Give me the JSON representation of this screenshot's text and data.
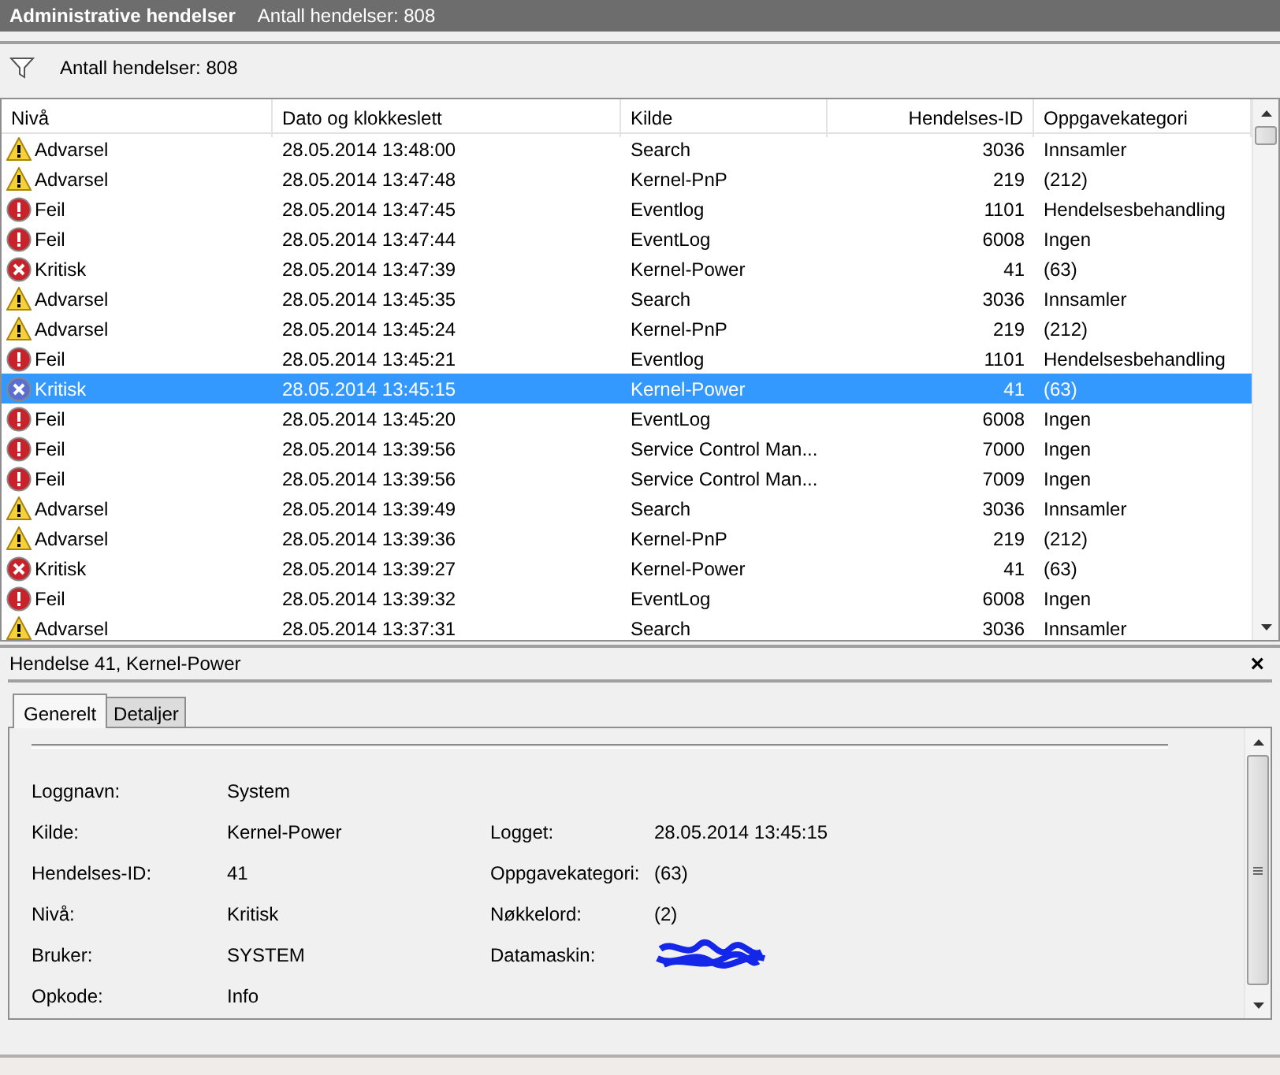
{
  "window": {
    "title": "Administrative hendelser",
    "subtitle": "Antall hendelser: 808"
  },
  "filter_bar": {
    "text": "Antall hendelser: 808"
  },
  "table": {
    "columns": [
      {
        "label": "Nivå",
        "kind": "text"
      },
      {
        "label": "Dato og klokkeslett",
        "kind": "text"
      },
      {
        "label": "Kilde",
        "kind": "text"
      },
      {
        "label": "Hendelses-ID",
        "kind": "number"
      },
      {
        "label": "Oppgavekategori",
        "kind": "text"
      }
    ],
    "rows": [
      {
        "kind": "warning",
        "level": "Advarsel",
        "date": "28.05.2014 13:48:00",
        "source": "Search",
        "id": "3036",
        "category": "Innsamler",
        "selected": false
      },
      {
        "kind": "warning",
        "level": "Advarsel",
        "date": "28.05.2014 13:47:48",
        "source": "Kernel-PnP",
        "id": "219",
        "category": "(212)",
        "selected": false
      },
      {
        "kind": "error",
        "level": "Feil",
        "date": "28.05.2014 13:47:45",
        "source": "Eventlog",
        "id": "1101",
        "category": "Hendelsesbehandling",
        "selected": false
      },
      {
        "kind": "error",
        "level": "Feil",
        "date": "28.05.2014 13:47:44",
        "source": "EventLog",
        "id": "6008",
        "category": "Ingen",
        "selected": false
      },
      {
        "kind": "critical",
        "level": "Kritisk",
        "date": "28.05.2014 13:47:39",
        "source": "Kernel-Power",
        "id": "41",
        "category": "(63)",
        "selected": false
      },
      {
        "kind": "warning",
        "level": "Advarsel",
        "date": "28.05.2014 13:45:35",
        "source": "Search",
        "id": "3036",
        "category": "Innsamler",
        "selected": false
      },
      {
        "kind": "warning",
        "level": "Advarsel",
        "date": "28.05.2014 13:45:24",
        "source": "Kernel-PnP",
        "id": "219",
        "category": "(212)",
        "selected": false
      },
      {
        "kind": "error",
        "level": "Feil",
        "date": "28.05.2014 13:45:21",
        "source": "Eventlog",
        "id": "1101",
        "category": "Hendelsesbehandling",
        "selected": false
      },
      {
        "kind": "critical",
        "level": "Kritisk",
        "date": "28.05.2014 13:45:15",
        "source": "Kernel-Power",
        "id": "41",
        "category": "(63)",
        "selected": true
      },
      {
        "kind": "error",
        "level": "Feil",
        "date": "28.05.2014 13:45:20",
        "source": "EventLog",
        "id": "6008",
        "category": "Ingen",
        "selected": false
      },
      {
        "kind": "error",
        "level": "Feil",
        "date": "28.05.2014 13:39:56",
        "source": "Service Control Man...",
        "id": "7000",
        "category": "Ingen",
        "selected": false
      },
      {
        "kind": "error",
        "level": "Feil",
        "date": "28.05.2014 13:39:56",
        "source": "Service Control Man...",
        "id": "7009",
        "category": "Ingen",
        "selected": false
      },
      {
        "kind": "warning",
        "level": "Advarsel",
        "date": "28.05.2014 13:39:49",
        "source": "Search",
        "id": "3036",
        "category": "Innsamler",
        "selected": false
      },
      {
        "kind": "warning",
        "level": "Advarsel",
        "date": "28.05.2014 13:39:36",
        "source": "Kernel-PnP",
        "id": "219",
        "category": "(212)",
        "selected": false
      },
      {
        "kind": "critical",
        "level": "Kritisk",
        "date": "28.05.2014 13:39:27",
        "source": "Kernel-Power",
        "id": "41",
        "category": "(63)",
        "selected": false
      },
      {
        "kind": "error",
        "level": "Feil",
        "date": "28.05.2014 13:39:32",
        "source": "EventLog",
        "id": "6008",
        "category": "Ingen",
        "selected": false
      },
      {
        "kind": "warning",
        "level": "Advarsel",
        "date": "28.05.2014 13:37:31",
        "source": "Search",
        "id": "3036",
        "category": "Innsamler",
        "selected": false
      }
    ]
  },
  "detail": {
    "title": "Hendelse 41, Kernel-Power",
    "close": "×",
    "tabs": [
      {
        "label": "Generelt",
        "selected": true
      },
      {
        "label": "Detaljer",
        "selected": false
      }
    ],
    "rows": [
      [
        {
          "label": "Loggnavn:",
          "kind": "text",
          "value": "System"
        }
      ],
      [
        {
          "label": "Kilde:",
          "kind": "text",
          "value": "Kernel-Power"
        },
        {
          "label": "Logget:",
          "kind": "text",
          "value": "28.05.2014 13:45:15"
        }
      ],
      [
        {
          "label": "Hendelses-ID:",
          "kind": "text",
          "value": "41"
        },
        {
          "label": "Oppgavekategori:",
          "kind": "text",
          "value": "(63)"
        }
      ],
      [
        {
          "label": "Nivå:",
          "kind": "text",
          "value": "Kritisk"
        },
        {
          "label": "Nøkkelord:",
          "kind": "text",
          "value": "(2)"
        }
      ],
      [
        {
          "label": "Bruker:",
          "kind": "text",
          "value": "SYSTEM"
        },
        {
          "label": "Datamaskin:",
          "kind": "redacted"
        }
      ],
      [
        {
          "label": "Opkode:",
          "kind": "text",
          "value": "Info"
        }
      ]
    ]
  }
}
